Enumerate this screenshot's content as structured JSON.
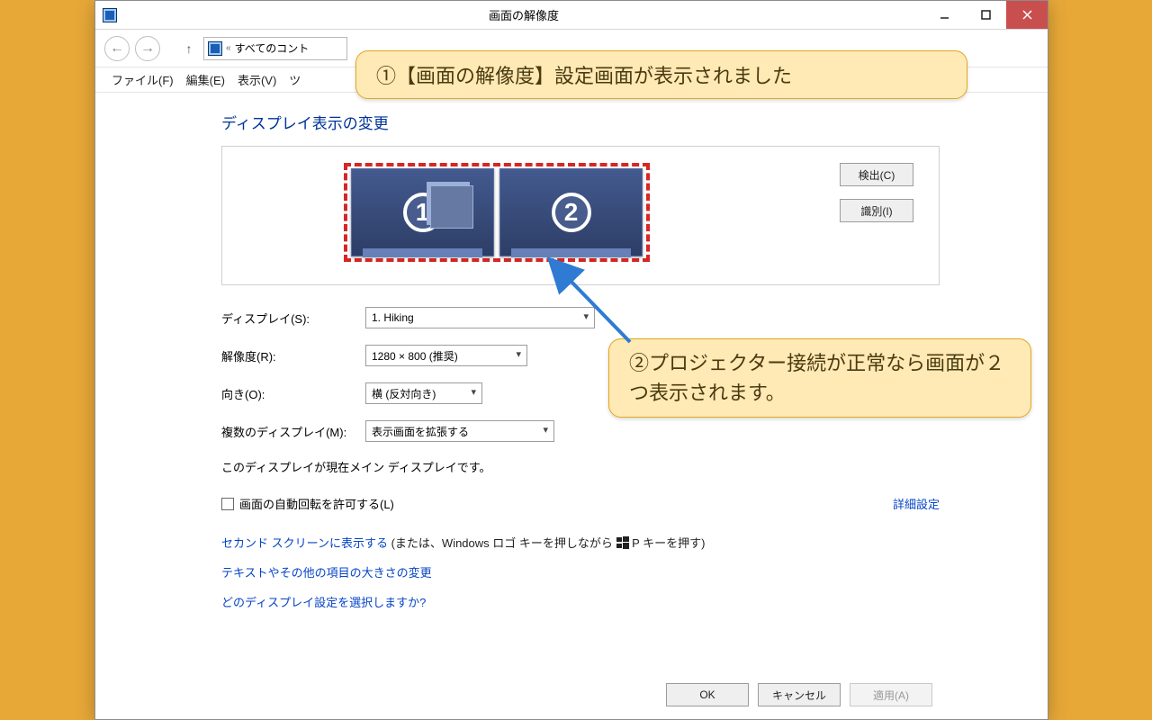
{
  "window": {
    "title": "画面の解像度",
    "breadcrumb_prefix": "«",
    "breadcrumb": "すべてのコント"
  },
  "menu": {
    "file": "ファイル(F)",
    "edit": "編集(E)",
    "view": "表示(V)",
    "tools_partial": "ツ"
  },
  "heading": "ディスプレイ表示の変更",
  "buttons": {
    "detect": "検出(C)",
    "identify": "識別(I)",
    "ok": "OK",
    "cancel": "キャンセル",
    "apply": "適用(A)"
  },
  "monitors": {
    "one": "1",
    "two": "2"
  },
  "form": {
    "display_label": "ディスプレイ(S):",
    "display_value": "1. Hiking",
    "resolution_label": "解像度(R):",
    "resolution_value": "1280 × 800 (推奨)",
    "orientation_label": "向き(O):",
    "orientation_value": "横 (反対向き)",
    "multi_label": "複数のディスプレイ(M):",
    "multi_value": "表示画面を拡張する"
  },
  "note": "このディスプレイが現在メイン ディスプレイです。",
  "checkbox_label": "画面の自動回転を許可する(L)",
  "advanced_link": "詳細設定",
  "links": {
    "second_screen": "セカンド スクリーンに表示する",
    "second_screen_suffix": " (または、Windows ロゴ キーを押しながら ",
    "second_screen_suffix2": " P キーを押す)",
    "text_size": "テキストやその他の項目の大きさの変更",
    "which": "どのディスプレイ設定を選択しますか?"
  },
  "callouts": {
    "c1": "①【画面の解像度】設定画面が表示されました",
    "c2": "②プロジェクター接続が正常なら画面が２つ表示されます。"
  }
}
